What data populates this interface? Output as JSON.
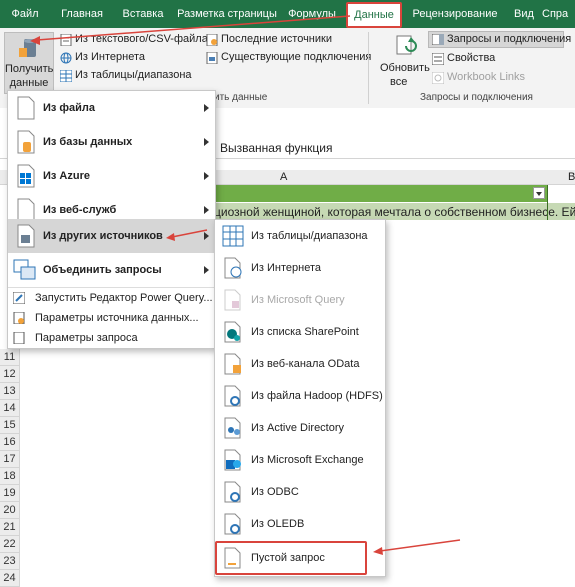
{
  "ribbon_tabs": [
    "Файл",
    "Главная",
    "Вставка",
    "Разметка страницы",
    "Формулы",
    "Данные",
    "Рецензирование",
    "Вид",
    "Спра"
  ],
  "ribbon": {
    "get_data_label_1": "Получить",
    "get_data_label_2": "данные",
    "from_text_csv": "Из текстового/CSV-файла",
    "from_web": "Из Интернета",
    "from_table": "Из таблицы/диапазона",
    "recent_sources": "Последние источники",
    "existing_connections": "Существующие подключения",
    "group_get_transform": "ить данные",
    "refresh_all_1": "Обновить",
    "refresh_all_2": "все",
    "queries_connections": "Запросы и подключения",
    "properties": "Свойства",
    "workbook_links": "Workbook Links",
    "group_queries": "Запросы и подключения"
  },
  "sheet": {
    "formula_text": "Вызванная функция",
    "col_a": "A",
    "col_b": "В",
    "cell_text": "циозной женщиной, которая мечтала о собственном бизнесе. Ей бы",
    "row_numbers": [
      "11",
      "12",
      "13",
      "14",
      "15",
      "16",
      "17",
      "18",
      "19",
      "20",
      "21",
      "22",
      "23",
      "24"
    ]
  },
  "menu1": {
    "items": [
      "Из файла",
      "Из базы данных",
      "Из Azure",
      "Из веб-служб",
      "Из других источников",
      "Объединить запросы"
    ],
    "sub_items": [
      "Запустить Редактор Power Query...",
      "Параметры источника данных...",
      "Параметры запроса"
    ]
  },
  "menu2": {
    "items": [
      "Из таблицы/диапазона",
      "Из Интернета",
      "Из Microsoft Query",
      "Из списка SharePoint",
      "Из веб-канала OData",
      "Из файла Hadoop (HDFS)",
      "Из Active Directory",
      "Из Microsoft Exchange",
      "Из ODBC",
      "Из OLEDB",
      "Пустой запрос"
    ]
  },
  "colors": {
    "excel_green": "#217346",
    "highlight_red": "#d9443c",
    "header_green": "#70ad47"
  }
}
